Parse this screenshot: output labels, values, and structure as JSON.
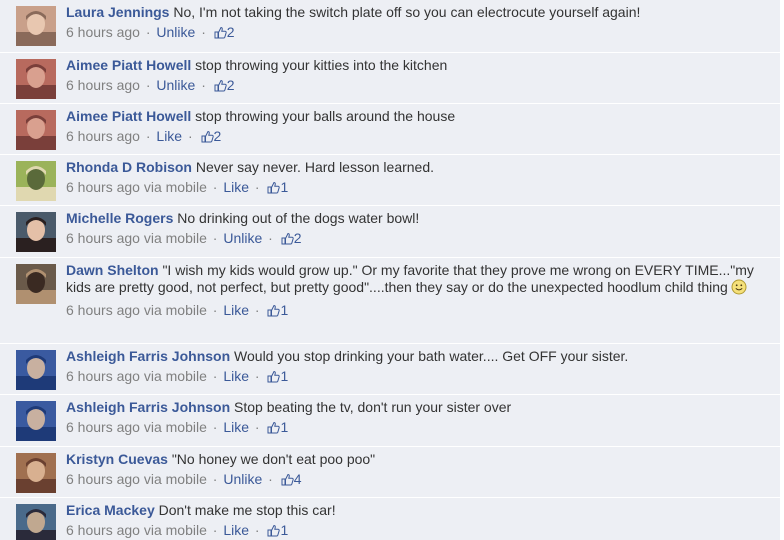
{
  "comments": [
    {
      "author": "Laura Jennings",
      "text": "No, I'm not taking the switch plate off so you can electrocute yourself again!",
      "time": "6 hours ago",
      "via": "",
      "action": "Unlike",
      "likes": "2",
      "avatar_colors": [
        "#c9a08a",
        "#8a6a5a",
        "#e8c7b0"
      ]
    },
    {
      "author": "Aimee Piatt Howell",
      "text": "stop throwing your kitties into the kitchen",
      "time": "6 hours ago",
      "via": "",
      "action": "Unlike",
      "likes": "2",
      "avatar_colors": [
        "#b86a5e",
        "#7a3f3a",
        "#d9a08f"
      ]
    },
    {
      "author": "Aimee Piatt Howell",
      "text": "stop throwing your balls around the house",
      "time": "6 hours ago",
      "via": "",
      "action": "Like",
      "likes": "2",
      "avatar_colors": [
        "#b86a5e",
        "#7a3f3a",
        "#d9a08f"
      ]
    },
    {
      "author": "Rhonda D Robison",
      "text": "Never say never. Hard lesson learned.",
      "time": "6 hours ago",
      "via": "via mobile",
      "action": "Like",
      "likes": "1",
      "avatar_colors": [
        "#9bb35a",
        "#e0d8b0",
        "#5a6a3a"
      ]
    },
    {
      "author": "Michelle Rogers",
      "text": "No drinking out of the dogs water bowl!",
      "time": "6 hours ago",
      "via": "via mobile",
      "action": "Unlike",
      "likes": "2",
      "avatar_colors": [
        "#4a5a6a",
        "#2a2020",
        "#e4c0a8"
      ]
    },
    {
      "author": "Dawn Shelton",
      "text": "\"I wish my kids would grow up.\" Or my favorite that they prove me wrong on EVERY TIME...\"my kids are pretty good, not perfect, but pretty good\"....then they say or do the unexpected hoodlum child thing",
      "emoticon": "smile",
      "time": "6 hours ago",
      "via": "via mobile",
      "action": "Like",
      "likes": "1",
      "avatar_colors": [
        "#6a5a4a",
        "#b09070",
        "#3a2a22"
      ]
    },
    {
      "author": "Ashleigh Farris Johnson",
      "text": "Would you stop drinking your bath water.... Get OFF your sister.",
      "time": "6 hours ago",
      "via": "via mobile",
      "action": "Like",
      "likes": "1",
      "avatar_colors": [
        "#3a5aa0",
        "#1e3a78",
        "#c8b0a0"
      ]
    },
    {
      "author": "Ashleigh Farris Johnson",
      "text": "Stop beating the tv, don't run your sister over",
      "time": "6 hours ago",
      "via": "via mobile",
      "action": "Like",
      "likes": "1",
      "avatar_colors": [
        "#3a5aa0",
        "#1e3a78",
        "#c8b0a0"
      ]
    },
    {
      "author": "Kristyn Cuevas",
      "text": "\"No honey we don't eat poo poo\"",
      "time": "6 hours ago",
      "via": "via mobile",
      "action": "Unlike",
      "likes": "4",
      "avatar_colors": [
        "#a07050",
        "#6a4030",
        "#d8b090"
      ]
    },
    {
      "author": "Erica Mackey",
      "text": "Don't make me stop this car!",
      "time": "6 hours ago",
      "via": "via mobile",
      "action": "Like",
      "likes": "1",
      "avatar_colors": [
        "#4a6a8a",
        "#2a2a3a",
        "#c0a890"
      ]
    }
  ],
  "colors": {
    "link": "#3b5998",
    "meta": "#808080",
    "background": "#edeff4"
  }
}
